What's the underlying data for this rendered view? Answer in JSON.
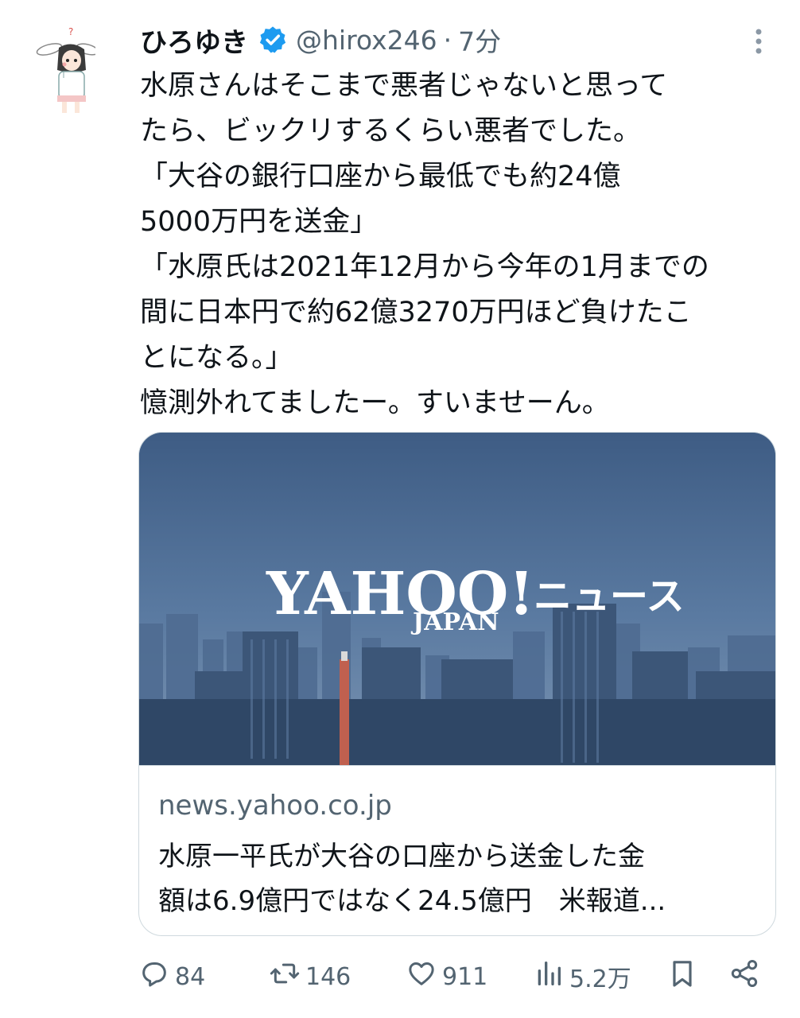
{
  "author": {
    "display_name": "ひろゆき",
    "handle": "@hirox246",
    "separator": "·",
    "time": "7分"
  },
  "tweet": {
    "lines": [
      "水原さんはそこまで悪者じゃないと思って",
      "たら、ビックリするくらい悪者でした。",
      "「大谷の銀行口座から最低でも約24億",
      "5000万円を送金」",
      "「水原氏は2021年12月から今年の1月までの",
      "間に日本円で約62億3270万円ほど負けたこ",
      "とになる。」",
      "憶測外れてましたー。すいませーん。"
    ]
  },
  "card": {
    "logo_text": "YAHOO!",
    "logo_sub": "JAPAN",
    "logo_news": "ニュース",
    "domain": "news.yahoo.co.jp",
    "title_lines": [
      "水原一平氏が大谷の口座から送金した金",
      "額は6.9億円ではなく24.5億円　米報道..."
    ]
  },
  "actions": {
    "replies": "84",
    "reposts": "146",
    "likes": "911",
    "views": "5.2万"
  },
  "colors": {
    "text": "#0f1419",
    "muted": "#536471",
    "verified": "#1d9bf0",
    "border": "#cfd9de"
  },
  "icons": {
    "verified": "verified-badge-icon",
    "more": "more-vertical-icon",
    "reply": "reply-icon",
    "repost": "repost-icon",
    "like": "heart-icon",
    "views": "bar-chart-icon",
    "bookmark": "bookmark-icon",
    "share": "share-icon"
  }
}
